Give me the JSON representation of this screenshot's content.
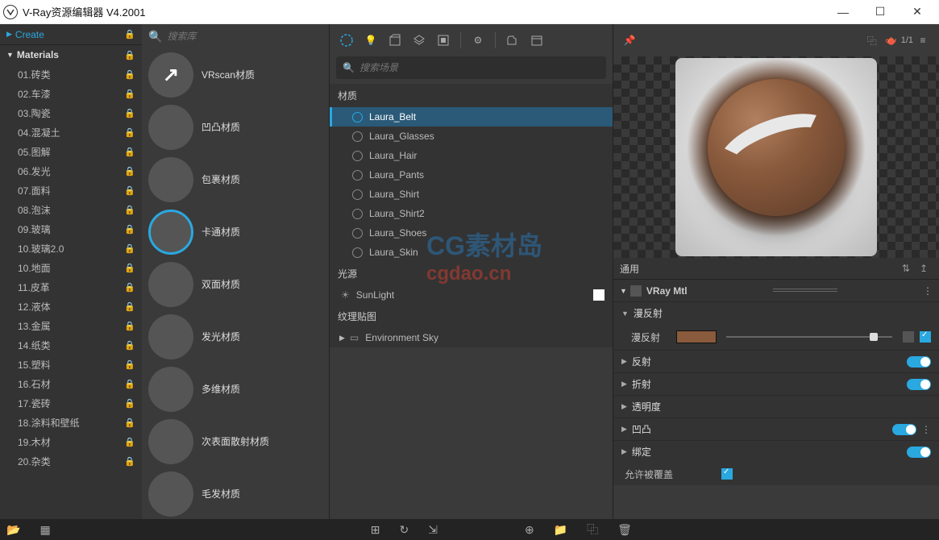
{
  "window": {
    "title": "V-Ray资源编辑器 V4.2001"
  },
  "sidebar": {
    "create": "Create",
    "materials_header": "Materials",
    "items": [
      "01.砖类",
      "02.车漆",
      "03.陶瓷",
      "04.混凝土",
      "05.图解",
      "06.发光",
      "07.面料",
      "08.泡沫",
      "09.玻璃",
      "10.玻璃2.0",
      "10.地面",
      "11.皮革",
      "12.液体",
      "13.金属",
      "14.纸类",
      "15.塑料",
      "16.石材",
      "17.瓷砖",
      "18.涂料和壁纸",
      "19.木材",
      "20.杂类"
    ]
  },
  "library": {
    "search_placeholder": "搜索库",
    "mats": [
      "VRscan材质",
      "凹凸材质",
      "包裹材质",
      "卡通材质",
      "双面材质",
      "发光材质",
      "多维材质",
      "次表面散射材质",
      "毛发材质"
    ]
  },
  "scene": {
    "search_placeholder": "搜索场景",
    "section_materials": "材质",
    "items": [
      "Laura_Belt",
      "Laura_Glasses",
      "Laura_Hair",
      "Laura_Pants",
      "Laura_Shirt",
      "Laura_Shirt2",
      "Laura_Shoes",
      "Laura_Skin"
    ],
    "section_lights": "光源",
    "light": "SunLight",
    "section_textures": "纹理贴图",
    "texture": "Environment Sky"
  },
  "inspector": {
    "general": "通用",
    "mtl_name": "VRay Mtl",
    "groups": {
      "diffuse_h": "漫反射",
      "diffuse_l": "漫反射",
      "reflect": "反射",
      "refract": "折射",
      "opacity": "透明度",
      "bump": "凹凸",
      "bind": "绑定",
      "override": "允许被覆盖"
    },
    "diffuse_color": "#8a5a3c"
  },
  "watermark": {
    "line1": "CG素材岛",
    "line2": "cgdao.cn"
  },
  "preview_counter": "1/1"
}
